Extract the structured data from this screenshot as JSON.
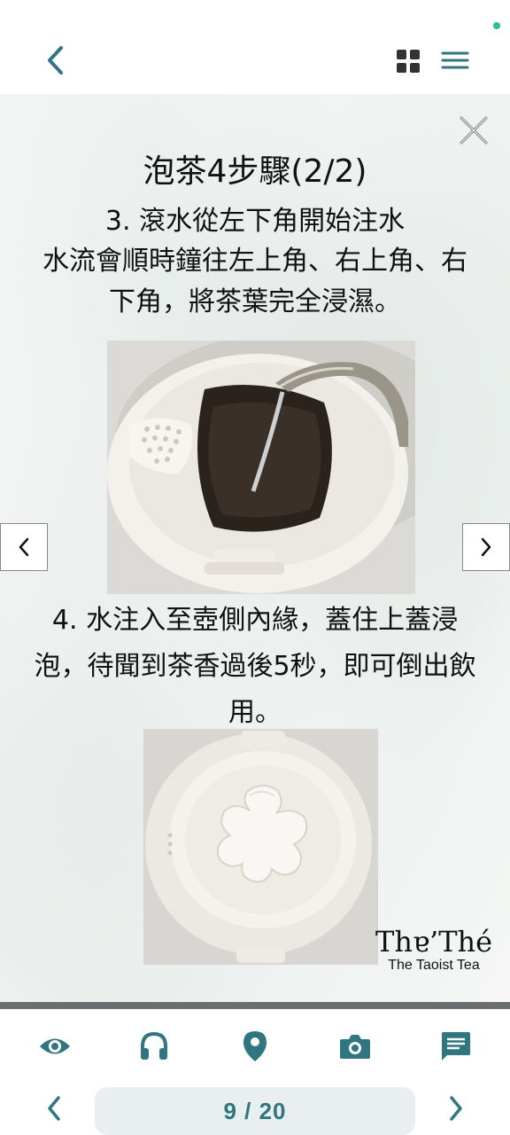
{
  "colors": {
    "accent": "#2f7681",
    "divider": "#6a6e6f",
    "pill_bg": "#e9eff0",
    "status_dot": "#2ec27e"
  },
  "header": {
    "back_icon": "chevron-left-icon",
    "grid_icon": "grid-view-icon",
    "menu_icon": "hamburger-menu-icon"
  },
  "slide": {
    "title": "泡茶4步驟(2/2)",
    "step3_heading": "3. 滾水從左下角開始注水",
    "step3_body": "水流會順時鐘往左上角、右上角、右下角，將茶葉完全浸濕。",
    "step4_body": "4. 水注入至壺側內緣，蓋住上蓋浸泡，待聞到茶香過後5秒，即可倒出飲用。",
    "logo_mark": "Thɐ’Thé",
    "logo_sub": "The Taoist Tea",
    "close_icon": "close-icon",
    "prev_icon": "chevron-left-icon",
    "next_icon": "chevron-right-icon"
  },
  "toolbar": {
    "items": [
      {
        "icon": "eye-icon"
      },
      {
        "icon": "headphones-icon"
      },
      {
        "icon": "location-pin-icon"
      },
      {
        "icon": "camera-icon"
      },
      {
        "icon": "chat-note-icon"
      }
    ]
  },
  "pager": {
    "current": 9,
    "total": 20,
    "label": "9 / 20"
  }
}
